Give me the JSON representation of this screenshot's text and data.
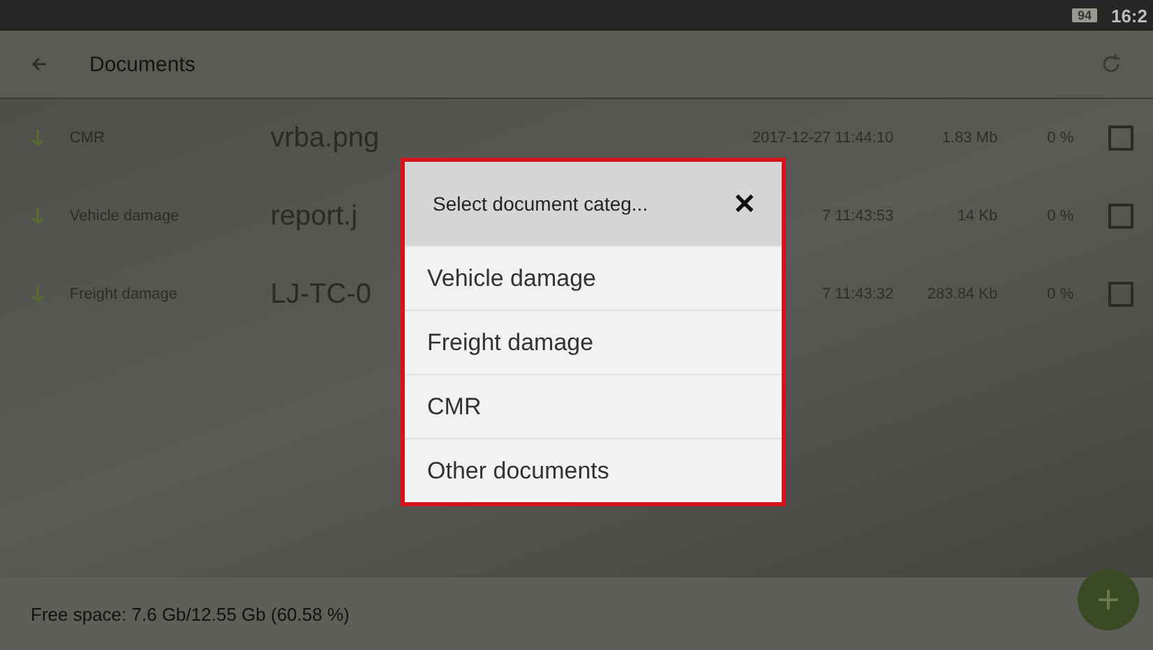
{
  "status_bar": {
    "battery": "94",
    "time": "16:2"
  },
  "toolbar": {
    "title": "Documents"
  },
  "rows": [
    {
      "category": "CMR",
      "file": "vrba.png",
      "date": "2017-12-27 11:44:10",
      "size": "1.83 Mb",
      "progress": "0 %",
      "checked": false
    },
    {
      "category": "Vehicle damage",
      "file": "report.j",
      "date": "7 11:43:53",
      "size": "14 Kb",
      "progress": "0 %",
      "checked": false
    },
    {
      "category": "Freight damage",
      "file": "LJ-TC-0",
      "date": "7 11:43:32",
      "size": "283.84 Kb",
      "progress": "0 %",
      "checked": false
    }
  ],
  "dialog": {
    "title": "Select document categ...",
    "close": "✕",
    "options": [
      "Vehicle damage",
      "Freight damage",
      "CMR",
      "Other documents"
    ]
  },
  "footer": {
    "free_space": "Free space: 7.6 Gb/12.55 Gb (60.58 %)"
  }
}
